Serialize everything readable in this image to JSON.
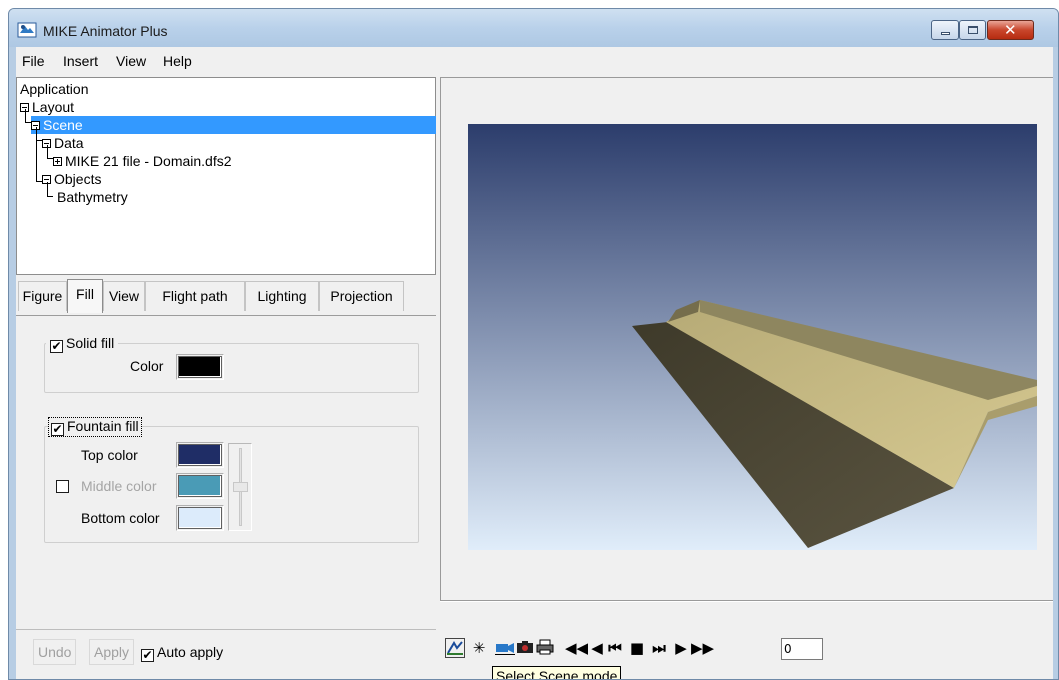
{
  "window": {
    "title": "MIKE Animator Plus",
    "controls": {
      "minimize": "minimize",
      "maximize": "maximize",
      "close": "close"
    }
  },
  "menu": [
    "File",
    "Insert",
    "View",
    "Help"
  ],
  "tree": {
    "root": "Application",
    "layout": "Layout",
    "scene": "Scene",
    "data": "Data",
    "file": "MIKE 21 file - Domain.dfs2",
    "objects": "Objects",
    "bathymetry": "Bathymetry",
    "selected": "Scene"
  },
  "tabs": [
    "Figure",
    "Fill",
    "View",
    "Flight path",
    "Lighting",
    "Projection"
  ],
  "active_tab": "Fill",
  "fill": {
    "solid": {
      "label": "Solid fill",
      "checked": true,
      "color_label": "Color",
      "color": "#000000"
    },
    "fountain": {
      "label": "Fountain fill",
      "checked": true,
      "top_label": "Top color",
      "top_color": "#1f2d66",
      "middle_label": "Middle color",
      "middle_checked": false,
      "middle_color": "#4a9bb6",
      "bottom_label": "Bottom color",
      "bottom_color": "#dcebfb"
    }
  },
  "buttons": {
    "undo": "Undo",
    "apply": "Apply",
    "auto_apply": "Auto apply",
    "auto_apply_checked": true
  },
  "playback": {
    "frame_value": "0"
  },
  "tooltip": "Select Scene mode",
  "scene_colors": {
    "sky_top": "#2c3d6c",
    "sky_bottom": "#e0edfa",
    "surface_light": "#c8bc86",
    "surface_dark": "#4f4a36"
  }
}
